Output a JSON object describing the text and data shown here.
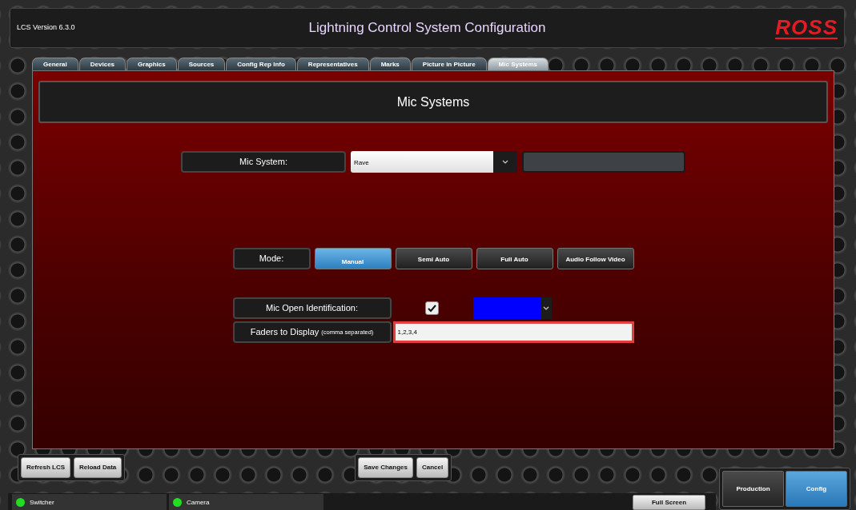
{
  "header": {
    "version": "LCS Version 6.3.0",
    "title": "Lightning Control System Configuration",
    "logo": "ROSS"
  },
  "tabs": [
    {
      "label": "General",
      "selected": false
    },
    {
      "label": "Devices",
      "selected": false
    },
    {
      "label": "Graphics",
      "selected": false
    },
    {
      "label": "Sources",
      "selected": false
    },
    {
      "label": "Config Rep Info",
      "selected": false
    },
    {
      "label": "Representatives",
      "selected": false
    },
    {
      "label": "Marks",
      "selected": false
    },
    {
      "label": "Picture in Picture",
      "selected": false
    },
    {
      "label": "Mic Systems",
      "selected": true
    }
  ],
  "panel": {
    "title": "Mic Systems"
  },
  "mic_system": {
    "label": "Mic System:",
    "value": "Rave"
  },
  "mode": {
    "label": "Mode:",
    "options": [
      {
        "label": "Manual",
        "selected": true
      },
      {
        "label": "Semi Auto",
        "selected": false
      },
      {
        "label": "Full Auto",
        "selected": false
      },
      {
        "label": "Audio Follow Video",
        "selected": false
      }
    ]
  },
  "mic_open_identification": {
    "label": "Mic Open Identification:",
    "checked": true,
    "color": "#0000ff"
  },
  "faders": {
    "label": "Faders to Display",
    "note": "(comma separated)",
    "value": "1,2,3,4"
  },
  "toolbar_left": [
    "Refresh LCS",
    "Reload Data"
  ],
  "toolbar_center": [
    "Save Changes",
    "Cancel"
  ],
  "status": [
    {
      "label": "Switcher",
      "color": "#22dd22"
    },
    {
      "label": "Camera",
      "color": "#22dd22"
    }
  ],
  "full_screen": "Full Screen",
  "views": [
    {
      "label": "Production",
      "selected": false
    },
    {
      "label": "Config",
      "selected": true
    }
  ]
}
